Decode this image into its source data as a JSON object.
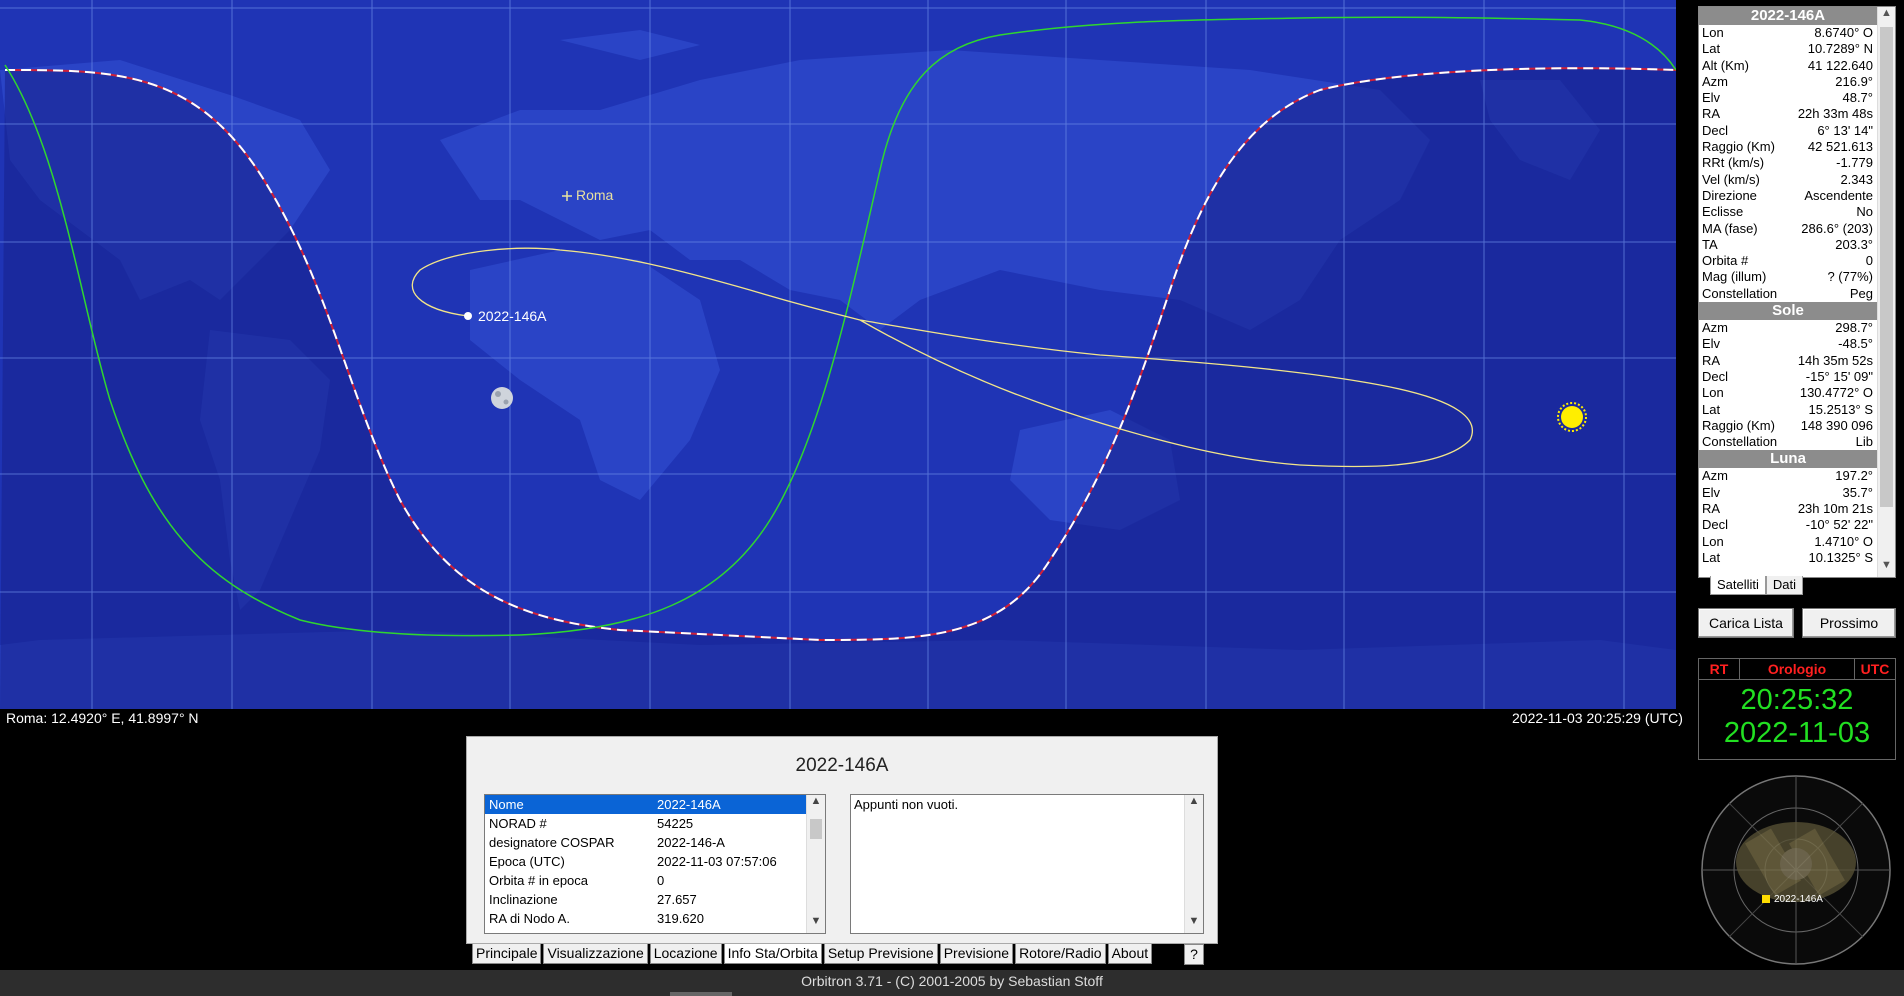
{
  "map": {
    "location_label": "Roma",
    "satellite_label": "2022-146A",
    "coords": "Roma: 12.4920° E, 41.8997° N",
    "timestamp": "2022-11-03 20:25:29 (UTC)",
    "colors": {
      "ocean": "#1f34b5",
      "land": "#2a44c6",
      "night": "#1a2090",
      "ground_track": "#f2e58a",
      "terminator": "#ffffff",
      "footprint": "#2fd62f",
      "sun": "#ffee00"
    }
  },
  "panel": {
    "sat_title": "2022-146A",
    "sat_rows": [
      {
        "k": "Lon",
        "v": "8.6740° O"
      },
      {
        "k": "Lat",
        "v": "10.7289° N"
      },
      {
        "k": "Alt (Km)",
        "v": "41 122.640"
      },
      {
        "k": "Azm",
        "v": "216.9°"
      },
      {
        "k": "Elv",
        "v": "48.7°"
      },
      {
        "k": "RA",
        "v": "22h 33m 48s"
      },
      {
        "k": "Decl",
        "v": "6° 13' 14\""
      },
      {
        "k": "Raggio (Km)",
        "v": "42 521.613"
      },
      {
        "k": "RRt (km/s)",
        "v": "-1.779"
      },
      {
        "k": "Vel (km/s)",
        "v": "2.343"
      },
      {
        "k": "Direzione",
        "v": "Ascendente"
      },
      {
        "k": "Eclisse",
        "v": "No"
      },
      {
        "k": "MA (fase)",
        "v": "286.6° (203)"
      },
      {
        "k": "TA",
        "v": "203.3°"
      },
      {
        "k": "Orbita #",
        "v": "0"
      },
      {
        "k": "Mag (illum)",
        "v": "? (77%)"
      },
      {
        "k": "Constellation",
        "v": "Peg"
      }
    ],
    "sun_title": "Sole",
    "sun_rows": [
      {
        "k": "Azm",
        "v": "298.7°"
      },
      {
        "k": "Elv",
        "v": "-48.5°"
      },
      {
        "k": "RA",
        "v": "14h 35m 52s"
      },
      {
        "k": "Decl",
        "v": "-15° 15' 09\""
      },
      {
        "k": "Lon",
        "v": "130.4772° O"
      },
      {
        "k": "Lat",
        "v": "15.2513° S"
      },
      {
        "k": "Raggio (Km)",
        "v": "148 390 096"
      },
      {
        "k": "Constellation",
        "v": "Lib"
      }
    ],
    "moon_title": "Luna",
    "moon_rows": [
      {
        "k": "Azm",
        "v": "197.2°"
      },
      {
        "k": "Elv",
        "v": "35.7°"
      },
      {
        "k": "RA",
        "v": "23h 10m 21s"
      },
      {
        "k": "Decl",
        "v": "-10° 52' 22\""
      },
      {
        "k": "Lon",
        "v": "1.4710° O"
      },
      {
        "k": "Lat",
        "v": "10.1325° S"
      }
    ],
    "tabs": [
      "Satelliti",
      "Dati"
    ],
    "load_list": "Carica Lista",
    "next": "Prossimo"
  },
  "clock": {
    "rt": "RT",
    "label": "Orologio",
    "utc": "UTC",
    "time": "20:25:32",
    "date": "2022-11-03"
  },
  "radar": {
    "sat_label": "2022-146A"
  },
  "dialog": {
    "title": "2022-146A",
    "rows": [
      {
        "k": "Nome",
        "v": "2022-146A"
      },
      {
        "k": "NORAD #",
        "v": "54225"
      },
      {
        "k": "designatore COSPAR",
        "v": "2022-146-A"
      },
      {
        "k": "Epoca (UTC)",
        "v": "2022-11-03 07:57:06"
      },
      {
        "k": "Orbita # in epoca",
        "v": "0"
      },
      {
        "k": "Inclinazione",
        "v": "27.657"
      },
      {
        "k": "RA di Nodo A.",
        "v": "319.620"
      }
    ],
    "notes": "Appunti non vuoti."
  },
  "main_tabs": [
    "Principale",
    "Visualizzazione",
    "Locazione",
    "Info Sta/Orbita",
    "Setup Previsione",
    "Previsione",
    "Rotore/Radio",
    "About"
  ],
  "help": "?",
  "status": "Orbitron 3.71 - (C) 2001-2005 by Sebastian Stoff"
}
